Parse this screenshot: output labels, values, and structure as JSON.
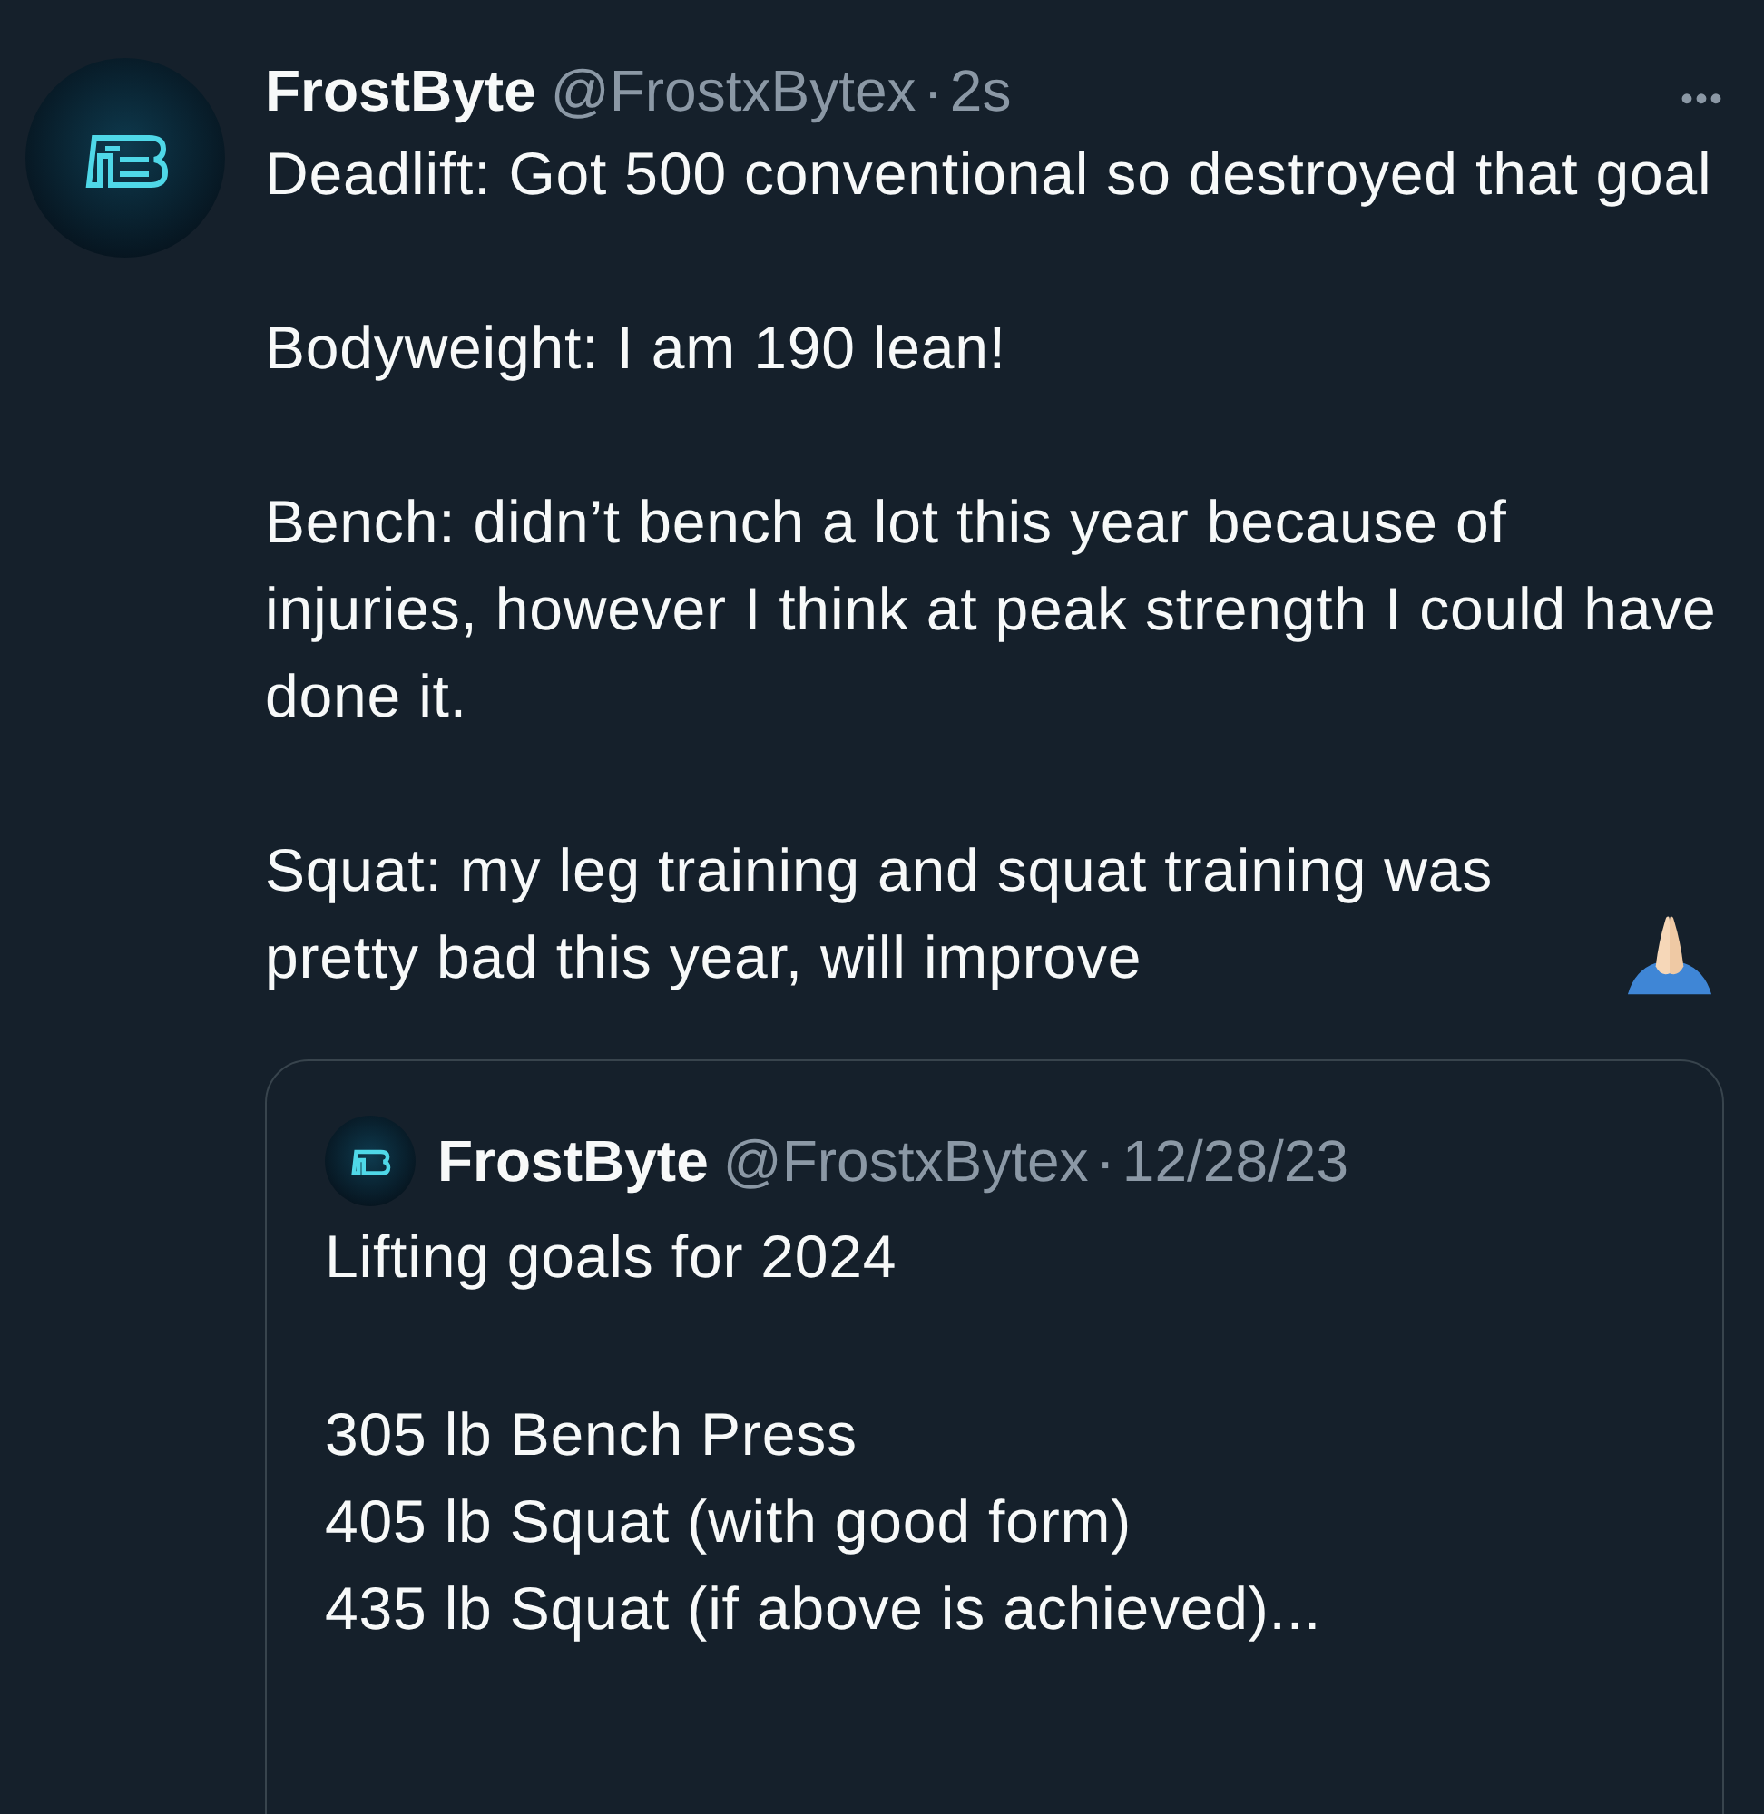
{
  "post": {
    "display_name": "FrostByte",
    "handle": "@FrostxBytex",
    "separator": "·",
    "time": "2s",
    "menu": "•••",
    "paragraphs": [
      "Deadlift: Got 500 conventional so destroyed that goal",
      "Bodyweight: I am 190 lean!",
      "Bench: didn’t bench a lot this year because of injuries, however I think at peak strength I could have done it.",
      "Squat: my leg training and squat training was pretty bad this year, will improve"
    ]
  },
  "quoted_post": {
    "display_name": "FrostByte",
    "handle": "@FrostxBytex",
    "separator": "·",
    "time": "12/28/23",
    "paragraphs": [
      "Lifting goals for 2024",
      "305 lb Bench Press\n405 lb Squat (with good form)\n435 lb Squat (if above is achieved)..."
    ]
  }
}
